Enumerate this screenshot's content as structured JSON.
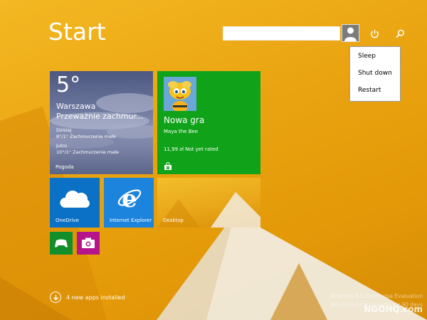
{
  "start_title": "Start",
  "search": {
    "placeholder": ""
  },
  "power_menu": {
    "items": [
      "Sleep",
      "Shut down",
      "Restart"
    ]
  },
  "tiles": {
    "weather": {
      "temperature": "5°",
      "city": "Warszawa",
      "condition": "Przeważnie zachmur...",
      "today_label": "Dzisiaj",
      "today_forecast": "8°/1° Zachmurzenie małe",
      "tomorrow_label": "Jutro",
      "tomorrow_forecast": "10°/1° Zachmurzenie małe",
      "label": "Pogoda"
    },
    "game": {
      "title": "Nowa gra",
      "subtitle": "Maya the Bee",
      "price": "11,99 zł Not yet rated"
    },
    "onedrive": {
      "label": "OneDrive"
    },
    "ie": {
      "label": "Internet Explorer"
    },
    "desktop": {
      "label": "Desktop"
    }
  },
  "apps_installed": "4 new apps installed",
  "watermark": {
    "line1": "Windows 8.1 Enterprise Evaluation",
    "line2": "Windows License valid for 90 days"
  },
  "site_mark": "NGOHQ.com",
  "colors": {
    "background": "#eaa411",
    "weather_tile": "#5f6a92",
    "game_tile": "#10a319",
    "onedrive_tile": "#0a71c6",
    "ie_tile": "#1c84dd",
    "xbox_tile": "#128f2a",
    "camera_tile": "#b4148c"
  },
  "icons": [
    "power-icon",
    "search-icon",
    "user-icon",
    "store-icon",
    "cloud-icon",
    "ie-logo-icon",
    "xbox-controller-icon",
    "camera-icon",
    "down-arrow-icon"
  ]
}
